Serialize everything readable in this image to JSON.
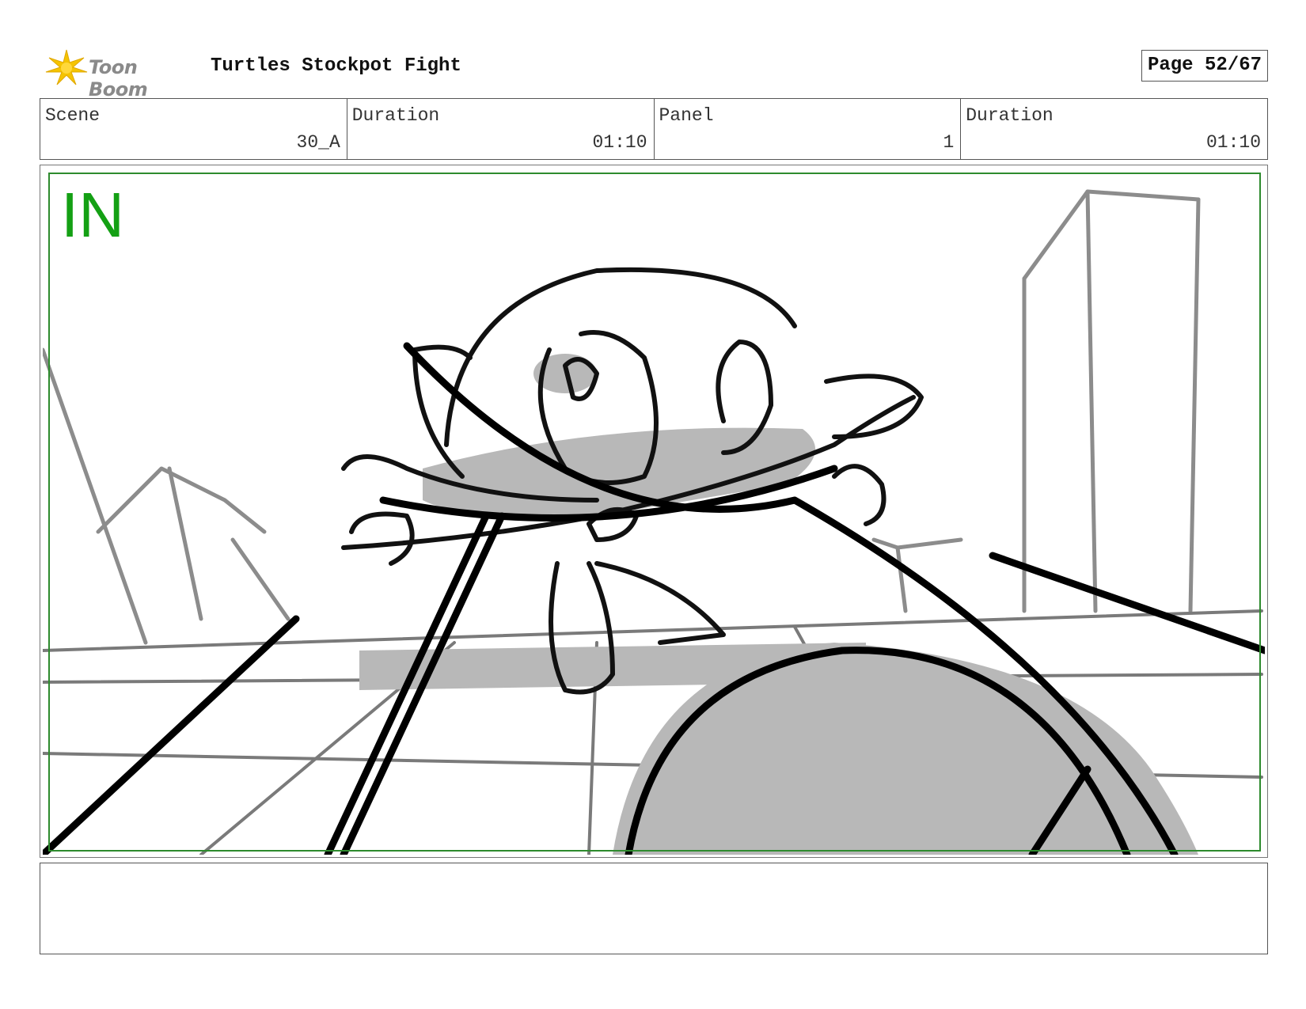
{
  "header": {
    "logo_text": "Toon Boom",
    "project_title": "Turtles Stockpot Fight",
    "page_label": "Page 52/67"
  },
  "info": {
    "scene_label": "Scene",
    "scene_value": "30_A",
    "scene_duration_label": "Duration",
    "scene_duration_value": "01:10",
    "panel_label": "Panel",
    "panel_value": "1",
    "panel_duration_label": "Duration",
    "panel_duration_value": "01:10"
  },
  "panel": {
    "transition_label": "IN",
    "transition_color": "#14a014",
    "safe_frame_color": "#2e8b2e",
    "image_description_icon": "storyboard-sketch"
  },
  "notes": {
    "text": ""
  }
}
